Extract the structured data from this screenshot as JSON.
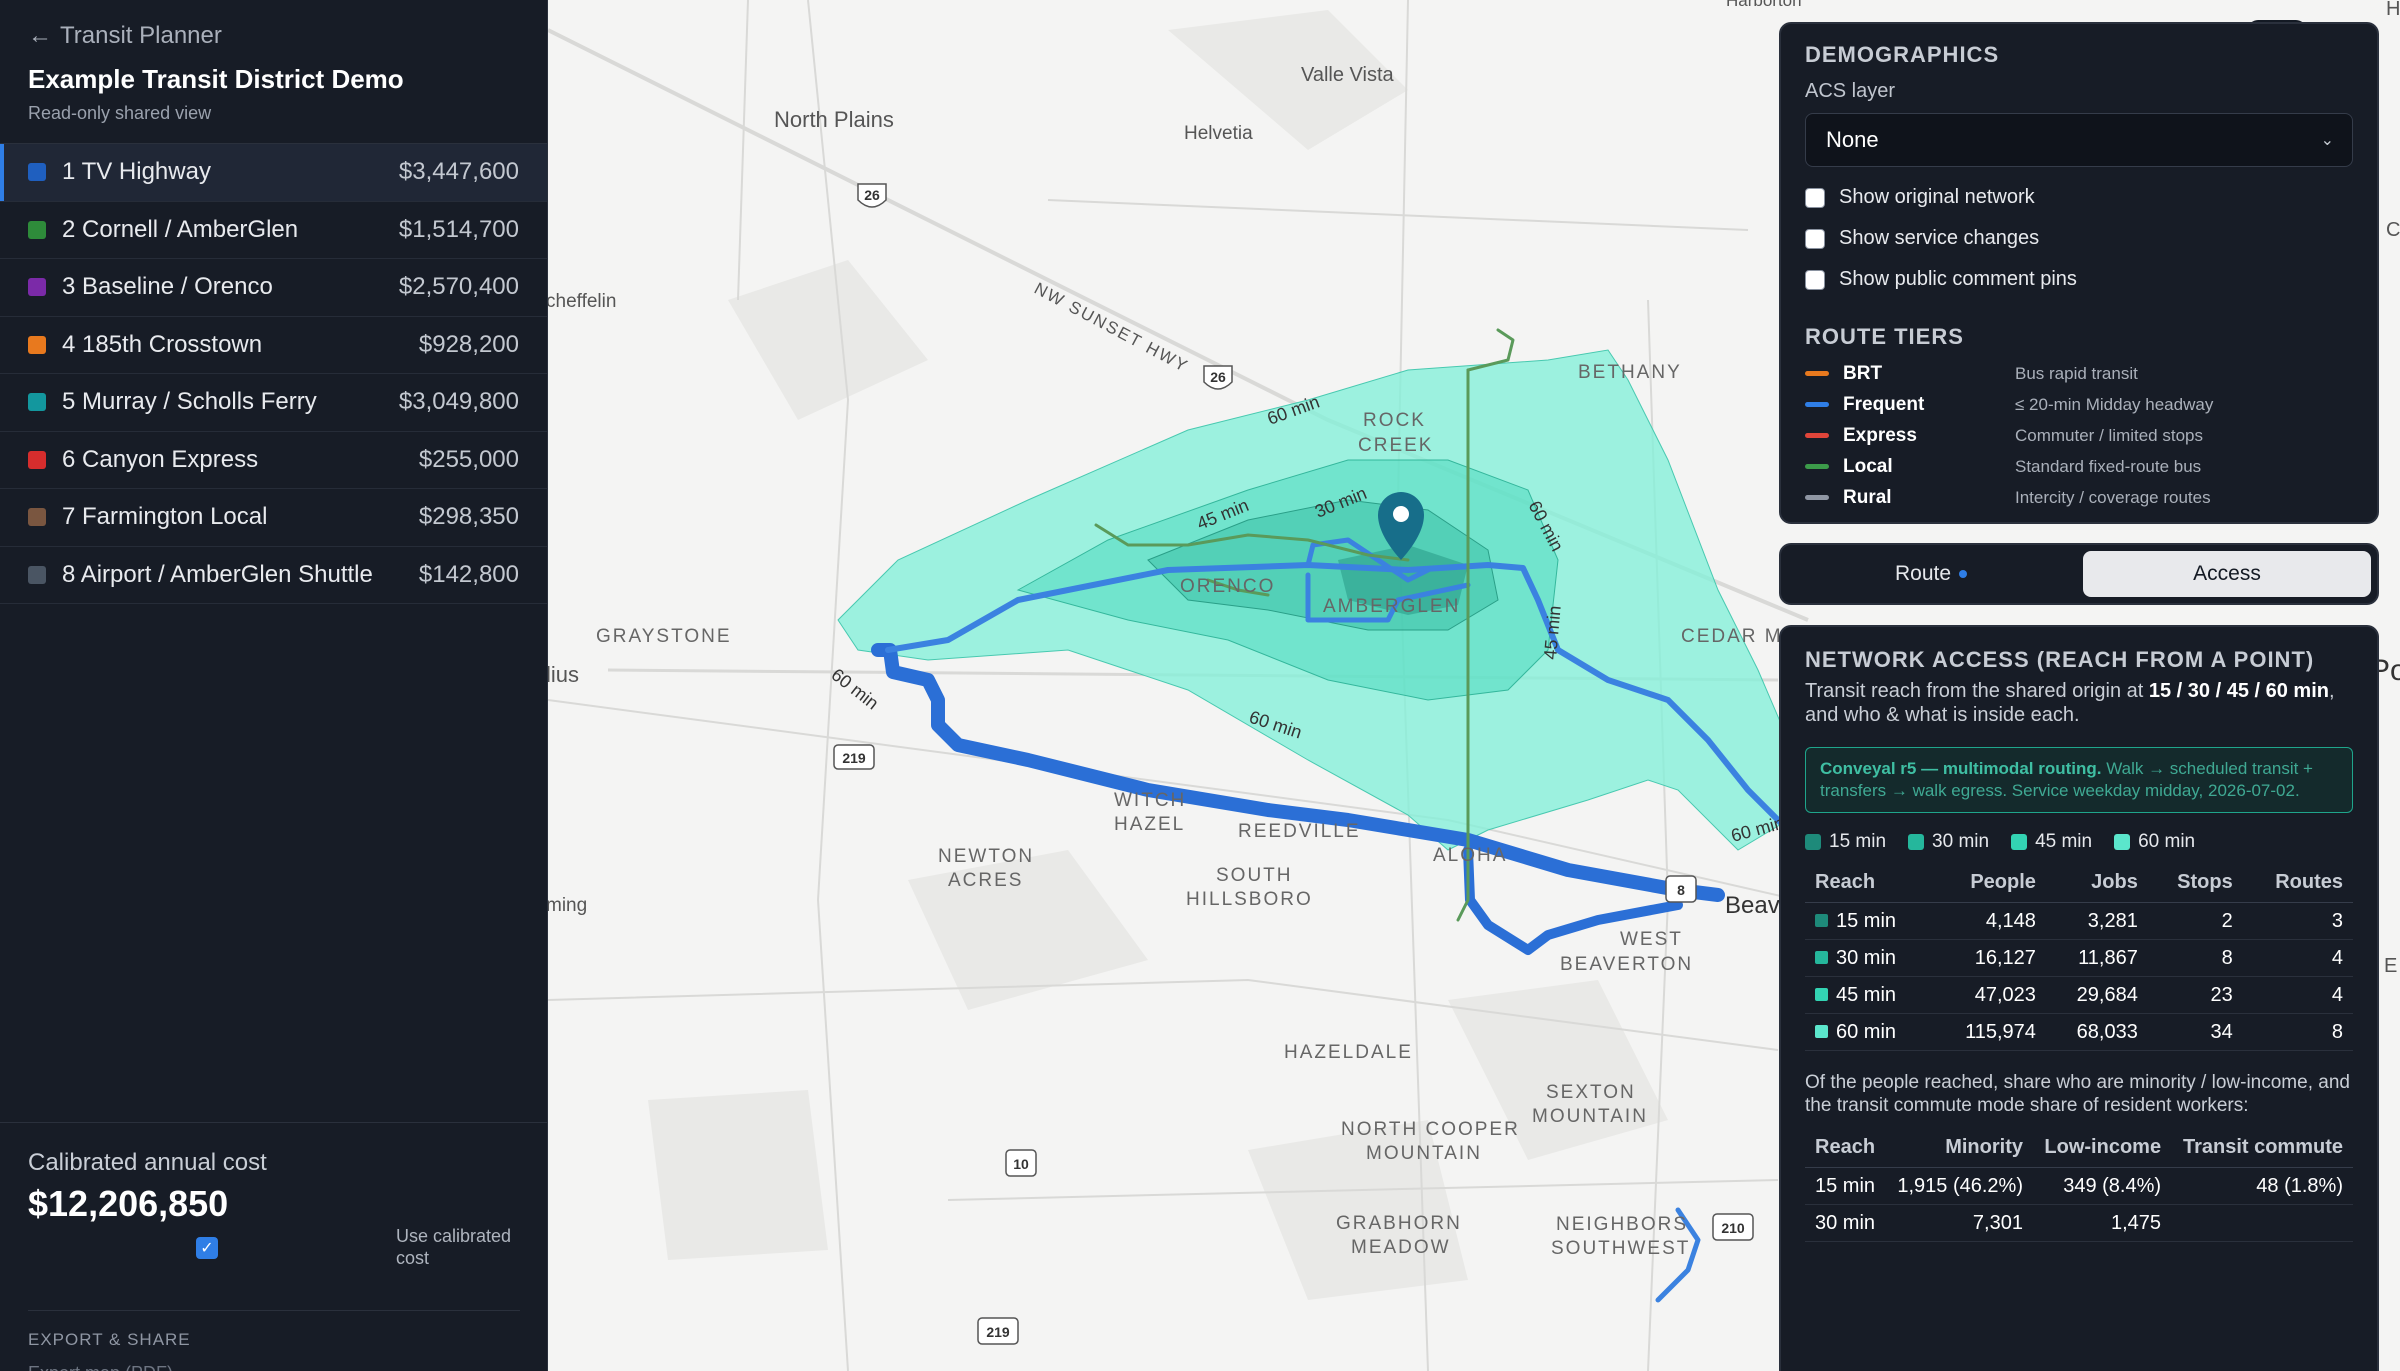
{
  "sidebar": {
    "back_label": "Transit Planner",
    "title": "Example Transit District Demo",
    "subtitle": "Read-only shared view",
    "routes": [
      {
        "label": "1 TV Highway",
        "cost": "$3,447,600",
        "color": "#1f5fbf"
      },
      {
        "label": "2 Cornell / AmberGlen",
        "cost": "$1,514,700",
        "color": "#2e8b3a"
      },
      {
        "label": "3 Baseline / Orenco",
        "cost": "$2,570,400",
        "color": "#7b2aa8"
      },
      {
        "label": "4 185th Crosstown",
        "cost": "$928,200",
        "color": "#e8791e"
      },
      {
        "label": "5 Murray / Scholls Ferry",
        "cost": "$3,049,800",
        "color": "#13979e"
      },
      {
        "label": "6 Canyon Express",
        "cost": "$255,000",
        "color": "#d62d2d"
      },
      {
        "label": "7 Farmington Local",
        "cost": "$298,350",
        "color": "#7a5640"
      },
      {
        "label": "8 Airport / AmberGlen Shuttle",
        "cost": "$142,800",
        "color": "#4a5563"
      }
    ],
    "cost_label": "Calibrated annual cost",
    "cost_value": "$12,206,850",
    "calibrated_label": "Use calibrated cost",
    "export_title": "EXPORT & SHARE",
    "export_item": "Export map (PDF)"
  },
  "map": {
    "place_labels": {
      "valle_vista": "Valle Vista",
      "north_plains": "North Plains",
      "helvetia": "Helvetia",
      "scheffelin": "cheffelin",
      "bethany": "BETHANY",
      "rock": "ROCK",
      "creek": "CREEK",
      "orenco": "ORENCO",
      "amberglen": "AMBERGLEN",
      "graystone": "GRAYSTONE",
      "cedar_m": "CEDAR M",
      "lius": "lius",
      "witch": "WITCH",
      "hazel": "HAZEL",
      "reedville": "REEDVILLE",
      "aloha": "ALOHA",
      "newton": "NEWTON",
      "acres": "ACRES",
      "south": "SOUTH",
      "hillsboro": "HILLSBORO",
      "ming": "ming",
      "beav": "Beav",
      "west": "WEST",
      "beaverton": "BEAVERTON",
      "hazeldale": "HAZELDALE",
      "sexton": "SEXTON",
      "mountain": "MOUNTAIN",
      "north_cooper": "NORTH COOPER",
      "mountain2": "MOUNTAIN",
      "grabhorn": "GRABHORN",
      "meadow": "MEADOW",
      "neighbors": "NEIGHBORS",
      "southwest": "SOUTHWEST",
      "harborton": "Harborton",
      "po": "Po",
      "h": "H",
      "c": "C",
      "e": "E",
      "sunset_hwy": "NW SUNSET HWY"
    },
    "shields": [
      "26",
      "26",
      "219",
      "8",
      "10",
      "210",
      "219"
    ],
    "isochrone_labels": [
      "60 min",
      "45 min",
      "30 min",
      "60 min",
      "45 min",
      "60 min",
      "60 min",
      "60 min"
    ]
  },
  "demographics": {
    "title": "DEMOGRAPHICS",
    "acs_label": "ACS layer",
    "acs_value": "None",
    "checkboxes": [
      "Show original network",
      "Show service changes",
      "Show public comment pins"
    ],
    "tiers_title": "ROUTE TIERS",
    "tiers": [
      {
        "name": "BRT",
        "desc": "Bus rapid transit",
        "color": "#e8791e"
      },
      {
        "name": "Frequent",
        "desc": "≤ 20-min Midday headway",
        "color": "#2f7ee6"
      },
      {
        "name": "Express",
        "desc": "Commuter / limited stops",
        "color": "#e0453a"
      },
      {
        "name": "Local",
        "desc": "Standard fixed-route bus",
        "color": "#3c9b4a"
      },
      {
        "name": "Rural",
        "desc": "Intercity / coverage routes",
        "color": "#8f96a3"
      }
    ]
  },
  "tabs": {
    "route": "Route",
    "access": "Access"
  },
  "access": {
    "title": "NETWORK ACCESS (REACH FROM A POINT)",
    "desc_pre": "Transit reach from the shared origin at ",
    "desc_bold": "15 / 30 / 45 / 60 min",
    "desc_post": ", and who & what is inside each.",
    "note_bold": "Conveyal r5 — multimodal routing.",
    "note_rest": " Walk → scheduled transit + transfers → walk egress. Service weekday midday, 2026-07-02.",
    "legend": [
      {
        "label": "15 min",
        "color": "#1e8a7a"
      },
      {
        "label": "30 min",
        "color": "#25b79c"
      },
      {
        "label": "45 min",
        "color": "#33d3b3"
      },
      {
        "label": "60 min",
        "color": "#5be6cc"
      }
    ],
    "headers": [
      "Reach",
      "People",
      "Jobs",
      "Stops",
      "Routes"
    ],
    "rows": [
      [
        "15 min",
        "4,148",
        "3,281",
        "2",
        "3"
      ],
      [
        "30 min",
        "16,127",
        "11,867",
        "8",
        "4"
      ],
      [
        "45 min",
        "47,023",
        "29,684",
        "23",
        "4"
      ],
      [
        "60 min",
        "115,974",
        "68,033",
        "34",
        "8"
      ]
    ],
    "desc2": "Of the people reached, share who are minority / low-income, and the transit commute mode share of resident workers:",
    "eq_headers": [
      "Reach",
      "Minority",
      "Low-income",
      "Transit commute"
    ],
    "eq_rows": [
      [
        "15 min",
        "1,915 (46.2%)",
        "349 (8.4%)",
        "48 (1.8%)"
      ],
      [
        "30 min",
        "7,301",
        "1,475",
        ""
      ]
    ]
  }
}
